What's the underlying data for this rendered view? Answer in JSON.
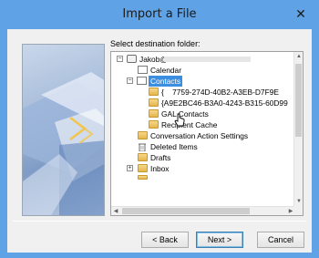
{
  "window": {
    "title": "Import a File",
    "close_glyph": "✕",
    "accent_color": "#5fa3e6"
  },
  "dialog": {
    "destination_label": "Select destination folder:"
  },
  "tree": {
    "items": [
      {
        "label": "Jakob@",
        "icon": "mailbox-icon",
        "expander": "−"
      },
      {
        "label": "Calendar",
        "icon": "calendar-icon"
      },
      {
        "label": "Contacts",
        "icon": "contacts-icon",
        "expander": "−",
        "selected": true
      },
      {
        "label": "{    7759-274D-40B2-A3EB-D7F9E",
        "icon": "folder-icon"
      },
      {
        "label": "{A9E2BC46-B3A0-4243-B315-60D99",
        "icon": "folder-icon"
      },
      {
        "label": "GAL Contacts",
        "icon": "folder-icon"
      },
      {
        "label": "Recipient Cache",
        "icon": "folder-icon"
      },
      {
        "label": "Conversation Action Settings",
        "icon": "folder-icon"
      },
      {
        "label": "Deleted Items",
        "icon": "deleted-items-icon"
      },
      {
        "label": "Drafts",
        "icon": "folder-icon"
      },
      {
        "label": "Inbox",
        "icon": "folder-icon",
        "expander": "+"
      }
    ],
    "selected_color": "#3c8fe0"
  },
  "buttons": {
    "back": "< Back",
    "next": "Next >",
    "cancel": "Cancel"
  }
}
